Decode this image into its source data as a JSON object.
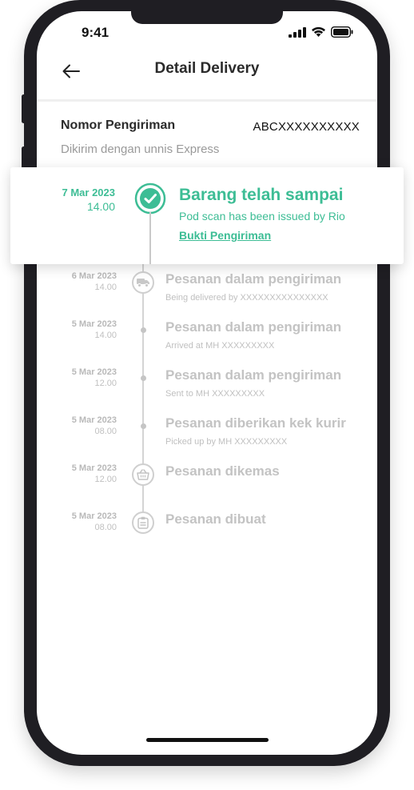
{
  "status_bar": {
    "time": "9:41",
    "signal_icon": "cellular-signal-icon",
    "wifi_icon": "wifi-icon",
    "battery_icon": "battery-icon"
  },
  "header": {
    "back_icon": "arrow-left-icon",
    "title": "Detail Delivery"
  },
  "shipment": {
    "label": "Nomor Pengiriman",
    "number": "ABCXXXXXXXXXX",
    "courier": "Dikirim dengan unnis Express"
  },
  "latest_status": {
    "date": "7 Mar 2023",
    "time": "14.00",
    "icon": "check-circle-icon",
    "title": "Barang telah sampai",
    "subtitle": "Pod scan has been issued by Rio",
    "link": "Bukti Pengiriman"
  },
  "timeline": [
    {
      "date": "6 Mar 2023",
      "time": "14.00",
      "title": "Pesanan dalam pengiriman",
      "subtitle": "Being delivered by XXXXXXXXXXXXXXX",
      "icon": "truck-icon"
    },
    {
      "date": "5 Mar 2023",
      "time": "14.00",
      "title": "Pesanan dalam pengiriman",
      "subtitle": "Arrived at MH XXXXXXXXX",
      "icon": "dot"
    },
    {
      "date": "5 Mar 2023",
      "time": "12.00",
      "title": "Pesanan dalam pengiriman",
      "subtitle": "Sent to MH XXXXXXXXX",
      "icon": "dot"
    },
    {
      "date": "5 Mar 2023",
      "time": "08.00",
      "title": "Pesanan diberikan kek kurir",
      "subtitle": "Picked up by MH XXXXXXXXX",
      "icon": "dot"
    },
    {
      "date": "5 Mar 2023",
      "time": "12.00",
      "title": "Pesanan dikemas",
      "subtitle": "",
      "icon": "basket-icon"
    },
    {
      "date": "5 Mar 2023",
      "time": "08.00",
      "title": "Pesanan dibuat",
      "subtitle": "",
      "icon": "clipboard-icon"
    }
  ],
  "colors": {
    "accent": "#3dbd95",
    "muted": "#c3c3c3",
    "frame": "#1f1e23"
  }
}
